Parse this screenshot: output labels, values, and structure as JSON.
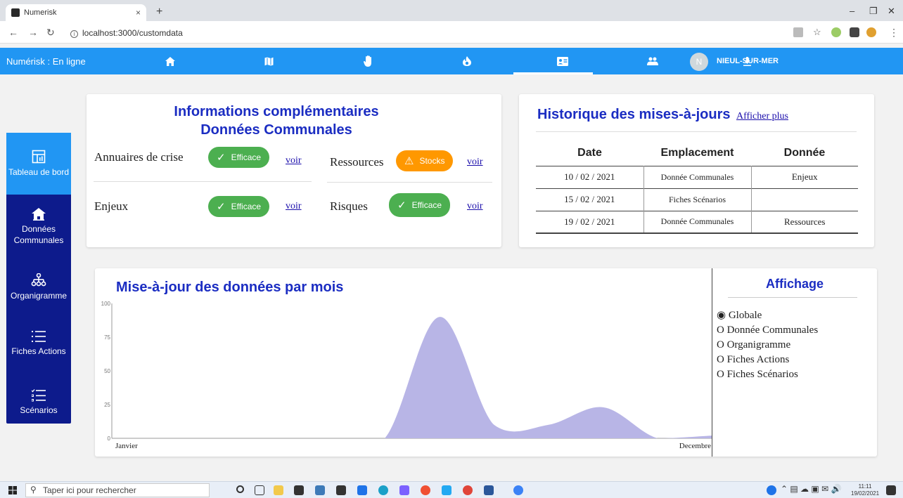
{
  "browser": {
    "tab_title": "Numerisk",
    "tab_close": "×",
    "new_tab": "+",
    "url": "localhost:3000/customdata"
  },
  "appbar": {
    "title": "Numérisk : En ligne",
    "avatar_initial": "N",
    "user": "NIEUL-SUR-MER",
    "nav_icons": [
      "home-icon",
      "map-icon",
      "hand-icon",
      "fire-icon",
      "contact-card-icon",
      "group-icon",
      "download-icon"
    ],
    "active_index": 4,
    "color": "#2196f3"
  },
  "sidebar": {
    "items": [
      {
        "label": "Tableau de bord",
        "icon": "dashboard-icon",
        "active": true
      },
      {
        "label": "Données Communales",
        "icon": "home-icon",
        "active": false
      },
      {
        "label": "Organigramme",
        "icon": "org-chart-icon",
        "active": false
      },
      {
        "label": "Fiches Actions",
        "icon": "list-icon",
        "active": false
      },
      {
        "label": "Scénarios",
        "icon": "checklist-icon",
        "active": false
      }
    ],
    "color": "#0d1b8c",
    "active_color": "#2196f3"
  },
  "info_card": {
    "title_line1": "Informations complémentaires",
    "title_line2": "Données Communales",
    "rows": [
      {
        "label": "Annuaires de crise",
        "badge": "Efficace",
        "badge_type": "success",
        "link": "voir"
      },
      {
        "label": "Ressources",
        "badge": "Stocks",
        "badge_type": "warning",
        "link": "voir"
      },
      {
        "label": "Enjeux",
        "badge": "Efficace",
        "badge_type": "success",
        "link": "voir"
      },
      {
        "label": "Risques",
        "badge": "Efficace",
        "badge_type": "success",
        "link": "voir"
      }
    ]
  },
  "history": {
    "title": "Historique des mises-à-jours",
    "more_link": "Afficher plus",
    "headers": [
      "Date",
      "Emplacement",
      "Donnée"
    ],
    "rows": [
      [
        "10 / 02 / 2021",
        "Donnée Communales",
        "Enjeux"
      ],
      [
        "15 / 02 / 2021",
        "Fiches Scénarios",
        ""
      ],
      [
        "19 / 02 / 2021",
        "Donnée Communales",
        "Ressources"
      ]
    ]
  },
  "chart_data": {
    "type": "area",
    "title": "Mise-à-jour des données par mois",
    "xlabel_start": "Janvier",
    "xlabel_end": "Decembre",
    "ylim": [
      0,
      100
    ],
    "yticks": [
      0,
      25,
      50,
      75,
      100
    ],
    "x": [
      1,
      2,
      3,
      4,
      5,
      6,
      7,
      8,
      9,
      10,
      11,
      12
    ],
    "values": [
      0,
      0,
      0,
      0,
      0,
      0,
      90,
      10,
      10,
      23,
      0,
      2
    ],
    "fill": "#b8b5e6"
  },
  "affichage": {
    "title": "Affichage",
    "options": [
      {
        "label": "Globale",
        "selected": true
      },
      {
        "label": "Donnée Communales",
        "selected": false
      },
      {
        "label": "Organigramme",
        "selected": false
      },
      {
        "label": "Fiches Actions",
        "selected": false
      },
      {
        "label": "Fiches Scénarios",
        "selected": false
      }
    ]
  },
  "taskbar": {
    "search_placeholder": "Taper ici pour rechercher",
    "time": "11:11",
    "date": "19/02/2021"
  }
}
